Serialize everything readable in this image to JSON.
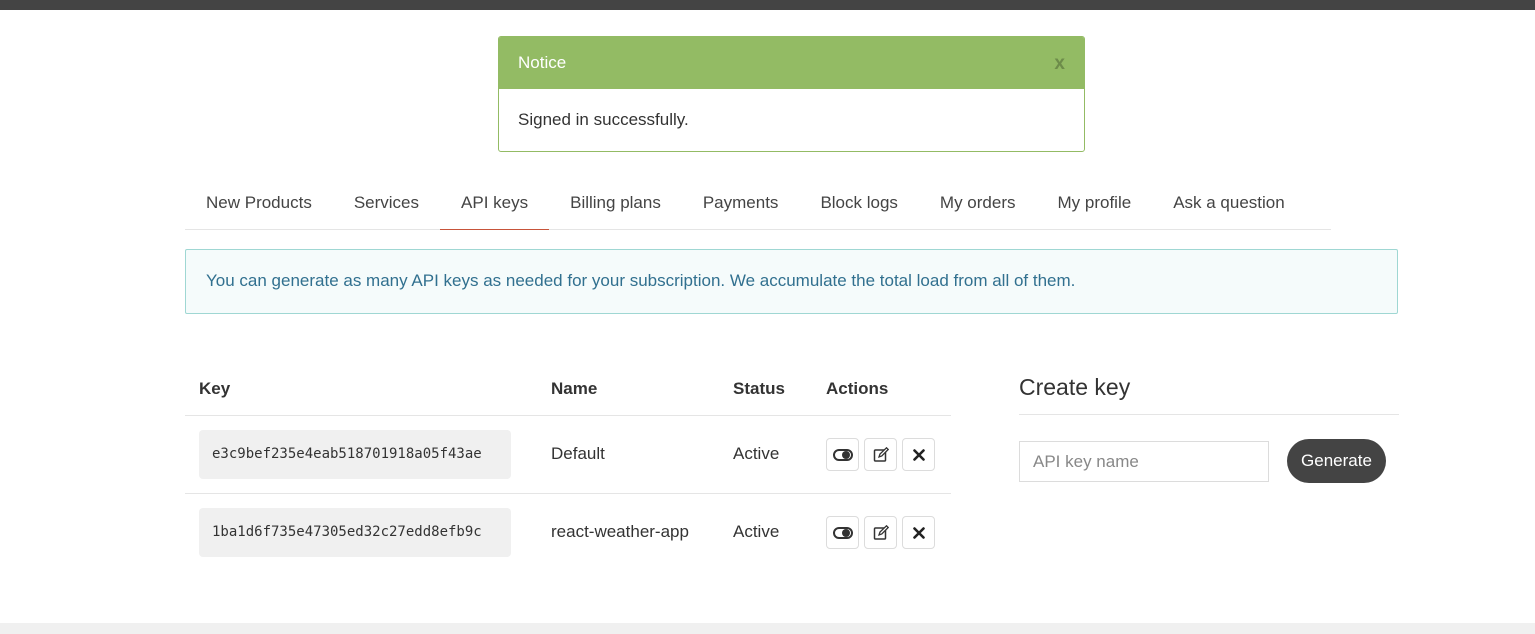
{
  "notice": {
    "title": "Notice",
    "close_label": "x",
    "message": "Signed in successfully."
  },
  "tabs": [
    {
      "label": "New Products",
      "active": false
    },
    {
      "label": "Services",
      "active": false
    },
    {
      "label": "API keys",
      "active": true
    },
    {
      "label": "Billing plans",
      "active": false
    },
    {
      "label": "Payments",
      "active": false
    },
    {
      "label": "Block logs",
      "active": false
    },
    {
      "label": "My orders",
      "active": false
    },
    {
      "label": "My profile",
      "active": false
    },
    {
      "label": "Ask a question",
      "active": false
    }
  ],
  "info_text": "You can generate as many API keys as needed for your subscription. We accumulate the total load from all of them.",
  "table": {
    "headers": {
      "key": "Key",
      "name": "Name",
      "status": "Status",
      "actions": "Actions"
    },
    "rows": [
      {
        "key": "e3c9bef235e4eab518701918a05f43ae",
        "name": "Default",
        "status": "Active"
      },
      {
        "key": "1ba1d6f735e47305ed32c27edd8efb9c",
        "name": "react-weather-app",
        "status": "Active"
      }
    ]
  },
  "create_key": {
    "title": "Create key",
    "input_placeholder": "API key name",
    "button_label": "Generate"
  },
  "icons": {
    "toggle": "toggle-icon",
    "edit": "edit-icon",
    "delete": "delete-icon"
  },
  "colors": {
    "notice_green": "#93bb64",
    "active_tab_underline": "#c7543a",
    "info_bg": "#f5fbfb",
    "info_text": "#31708f",
    "dark_button": "#444444"
  }
}
